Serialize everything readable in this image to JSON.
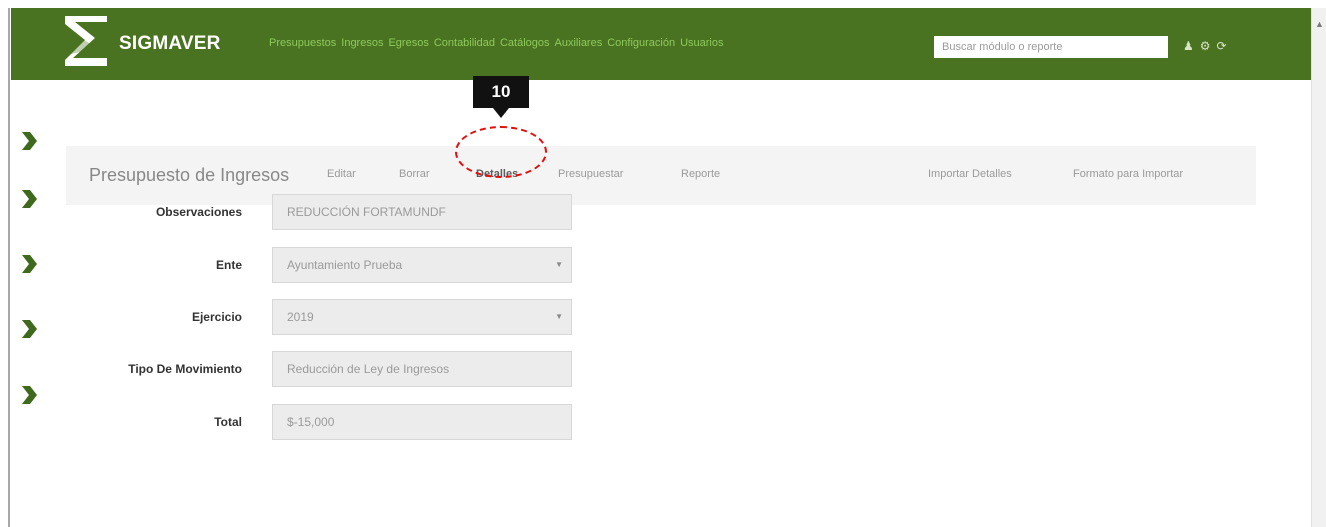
{
  "navbar": {
    "brand": "SIGMAVER",
    "menu": [
      "Presupuestos",
      "Ingresos",
      "Egresos",
      "Contabilidad",
      "Catálogos",
      "Auxiliares",
      "Configuración",
      "Usuarios"
    ],
    "search_placeholder": "Buscar módulo o reporte",
    "icons": [
      "user-icon",
      "settings-icon",
      "logout-icon"
    ]
  },
  "annotation": {
    "step_number": "10"
  },
  "toolbar": {
    "title": "Presupuesto de Ingresos",
    "actions": [
      "Editar",
      "Borrar",
      "Detalles",
      "Presupuestar",
      "Reporte"
    ],
    "right_actions": [
      "Importar Detalles",
      "Formato para Importar"
    ]
  },
  "form": {
    "observaciones": {
      "label": "Observaciones",
      "value": "REDUCCIÓN FORTAMUNDF"
    },
    "ente": {
      "label": "Ente",
      "value": "Ayuntamiento Prueba"
    },
    "ejercicio": {
      "label": "Ejercicio",
      "value": "2019"
    },
    "tipo_movimiento": {
      "label": "Tipo De Movimiento",
      "value": "Reducción de Ley de Ingresos"
    },
    "total": {
      "label": "Total",
      "value": "$-15,000"
    }
  },
  "colors": {
    "navbar": "#4a7321",
    "accent_arrow": "#3f6a1d",
    "annotation_circle": "#e01010"
  }
}
